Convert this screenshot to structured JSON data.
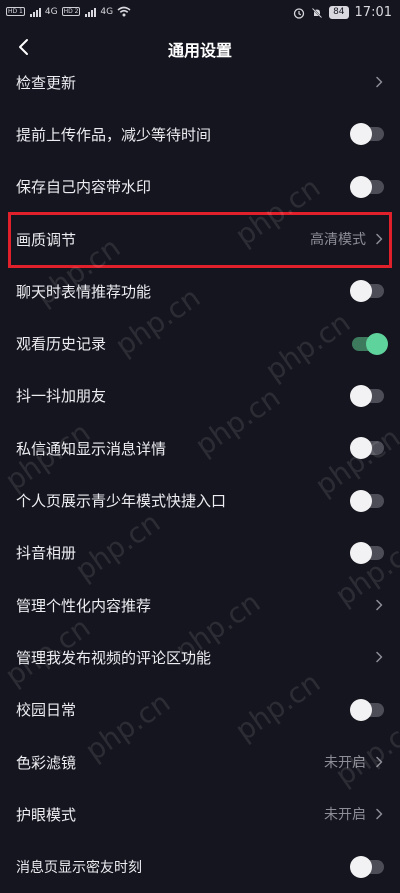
{
  "status_bar": {
    "sim1_label": "HD 1",
    "sim2_label": "HD 2",
    "network": "4G",
    "network2": "4G",
    "battery": "84",
    "time": "17:01"
  },
  "header": {
    "title": "通用设置"
  },
  "settings": [
    {
      "label": "检查更新",
      "control": "chevron"
    },
    {
      "label": "提前上传作品，减少等待时间",
      "control": "toggle",
      "on": false
    },
    {
      "label": "保存自己内容带水印",
      "control": "toggle",
      "on": false
    },
    {
      "label": "画质调节",
      "control": "chevron",
      "value": "高清模式"
    },
    {
      "label": "聊天时表情推荐功能",
      "control": "toggle",
      "on": false
    },
    {
      "label": "观看历史记录",
      "control": "toggle",
      "on": true
    },
    {
      "label": "抖一抖加朋友",
      "control": "toggle",
      "on": false
    },
    {
      "label": "私信通知显示消息详情",
      "control": "toggle",
      "on": false
    },
    {
      "label": "个人页展示青少年模式快捷入口",
      "control": "toggle",
      "on": false
    },
    {
      "label": "抖音相册",
      "control": "toggle",
      "on": false
    },
    {
      "label": "管理个性化内容推荐",
      "control": "chevron"
    },
    {
      "label": "管理我发布视频的评论区功能",
      "control": "chevron"
    },
    {
      "label": "校园日常",
      "control": "toggle",
      "on": false
    },
    {
      "label": "色彩滤镜",
      "control": "chevron",
      "value": "未开启"
    },
    {
      "label": "护眼模式",
      "control": "chevron",
      "value": "未开启"
    },
    {
      "label": "消息页显示密友时刻",
      "control": "toggle",
      "on": false
    }
  ],
  "watermark_text": "php.cn",
  "colors": {
    "background": "#15151f",
    "toggle_on": "#5fd39c",
    "highlight": "#e0202a"
  },
  "icons": {
    "back": "chevron-left-icon",
    "row_arrow": "chevron-right-icon"
  }
}
